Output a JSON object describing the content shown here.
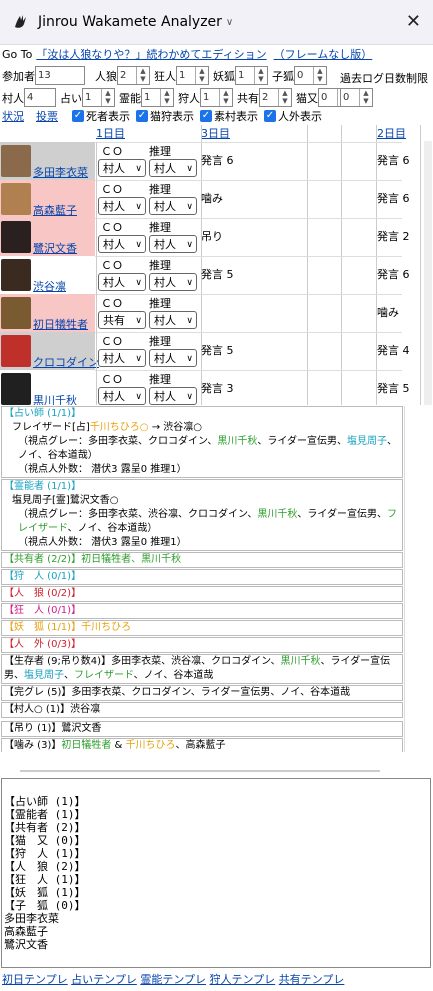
{
  "window": {
    "title": "Jinrou Wakamete Analyzer"
  },
  "goto": {
    "prefix": "Go To",
    "link1": "「汝は人狼なりや？」続わかめてエディション",
    "link2": "（フレームなし版）"
  },
  "settings": {
    "row1": [
      {
        "label": "参加者",
        "value": "13"
      },
      {
        "label": "人狼",
        "value": "2"
      },
      {
        "label": "狂人",
        "value": "1"
      },
      {
        "label": "妖狐",
        "value": "1"
      },
      {
        "label": "子狐",
        "value": "0"
      }
    ],
    "row2": [
      {
        "label": "村人",
        "value": "4"
      },
      {
        "label": "占い",
        "value": "1"
      },
      {
        "label": "霊能",
        "value": "1"
      },
      {
        "label": "狩人",
        "value": "1"
      },
      {
        "label": "共有",
        "value": "2"
      },
      {
        "label": "猫又",
        "value": "0"
      }
    ],
    "log_limit_label": "過去ログ日数制限",
    "log_limit_value": "0"
  },
  "menu": {
    "status": "状況",
    "vote": "投票",
    "show_dead": "死者表示",
    "show_catcher": "猫狩表示",
    "show_plain": "素村表示",
    "show_outsider": "人外表示"
  },
  "grid": {
    "headers": {
      "day1": "1日目",
      "day3": "3日目",
      "day2": "2日目"
    },
    "co_label": "ＣＯ",
    "guess_label": "推理",
    "players": [
      {
        "name": "多田李衣菜",
        "co": "村人",
        "guess": "村人",
        "d3": "発言 6",
        "d2": "発言 6",
        "bg": "#cfcfcf",
        "av": "#8a6a4a"
      },
      {
        "name": "高森藍子",
        "co": "村人",
        "guess": "村人",
        "d3": "噛み",
        "d2": "発言 6",
        "bg": "#f9c6c6",
        "av": "#b08050"
      },
      {
        "name": "鷺沢文香",
        "co": "村人",
        "guess": "村人",
        "d3": "吊り",
        "d2": "発言 2",
        "bg": "#f9c6c6",
        "av": "#2a2020"
      },
      {
        "name": "渋谷凛",
        "co": "村人",
        "guess": "村人",
        "d3": "発言 5",
        "d2": "発言 6",
        "bg": "#ffffff",
        "av": "#3a2a20"
      },
      {
        "name": "初日犠牲者",
        "co": "共有",
        "guess": "村人",
        "d3": "",
        "d2": "噛み",
        "bg": "#f9c6c6",
        "av": "#7a5a30"
      },
      {
        "name": "クロコダイン",
        "co": "村人",
        "guess": "村人",
        "d3": "発言 5",
        "d2": "発言 4",
        "bg": "#cfcfcf",
        "av": "#c0302a"
      },
      {
        "name": "黒川千秋",
        "co": "村人",
        "guess": "村人",
        "d3": "発言 3",
        "d2": "発言 5",
        "bg": "#ffffff",
        "av": "#202020"
      }
    ]
  },
  "info": {
    "seer_head": "【占い師 (1/1)】",
    "seer_line1_a": "フレイザード[占]",
    "seer_line1_b": "千川ちひろ○",
    "seer_line1_c": " → 渋谷凛○",
    "seer_gray_a": "（視点グレー：多田李衣菜、クロコダイン、",
    "seer_gray_b": "黒川千秋",
    "seer_gray_c": "、ライダー宣伝男、",
    "seer_gray_d": "塩見周子",
    "seer_gray_e": "、ノイ、谷本道哉）",
    "seer_out": "（視点人外数： 潜伏3 露呈0 推理1）",
    "medium_head": "【霊能者 (1/1)】",
    "medium_line1": "塩見周子[霊]鷺沢文香○",
    "medium_gray_a": "（視点グレー：多田李衣菜、渋谷凛、クロコダイン、",
    "medium_gray_b": "黒川千秋",
    "medium_gray_c": "、ライダー宣伝男、",
    "medium_gray_d": "フレイザード",
    "medium_gray_e": "、ノイ、谷本道哉）",
    "medium_out": "（視点人外数： 潜伏3 露呈0 推理1）",
    "shared": "【共有者 (2/2)】初日犠牲者、黒川千秋",
    "hunter": "【狩　人 (0/1)】",
    "wolf": "【人　狼 (0/2)】",
    "madman": "【狂　人 (0/1)】",
    "fox": "【妖　狐 (1/1)】千川ちひろ",
    "nonhuman": "【人　外 (0/3)】",
    "alive_a": "【生存者 (9;吊り数4)】多田李衣菜、渋谷凛、クロコダイン、",
    "alive_b": "黒川千秋",
    "alive_c": "、ライダー宣伝男、",
    "alive_d": "塩見周子",
    "alive_e": "、",
    "alive_f": "フレイザード",
    "alive_g": "、ノイ、谷本道哉",
    "gray": "【完グレ (5)】多田李衣菜、クロコダイン、ライダー宣伝男、ノイ、谷本道哉",
    "villager_circle": "【村人○ (1)】渋谷凛",
    "hanged": "【吊り (1)】鷺沢文香",
    "bitten_a": "【噛み (3)】",
    "bitten_b": "初日犠牲者",
    "bitten_c": " & ",
    "bitten_d": "千川ちひろ",
    "bitten_e": "、高森藍子"
  },
  "textarea": {
    "content": "【占い師 (1)】\n【霊能者 (1)】\n【共有者 (2)】\n【猫　又 (0)】\n【狩　人 (1)】\n【人　狼 (2)】\n【狂　人 (1)】\n【妖　狐 (1)】\n【子　狐 (0)】\n多田李衣菜\n高森藍子\n鷺沢文香"
  },
  "templates": {
    "t1": "初日テンプレ",
    "t2": "占いテンプレ",
    "t3": "霊能テンプレ",
    "t4": "狩人テンプレ",
    "t5": "共有テンプレ"
  }
}
